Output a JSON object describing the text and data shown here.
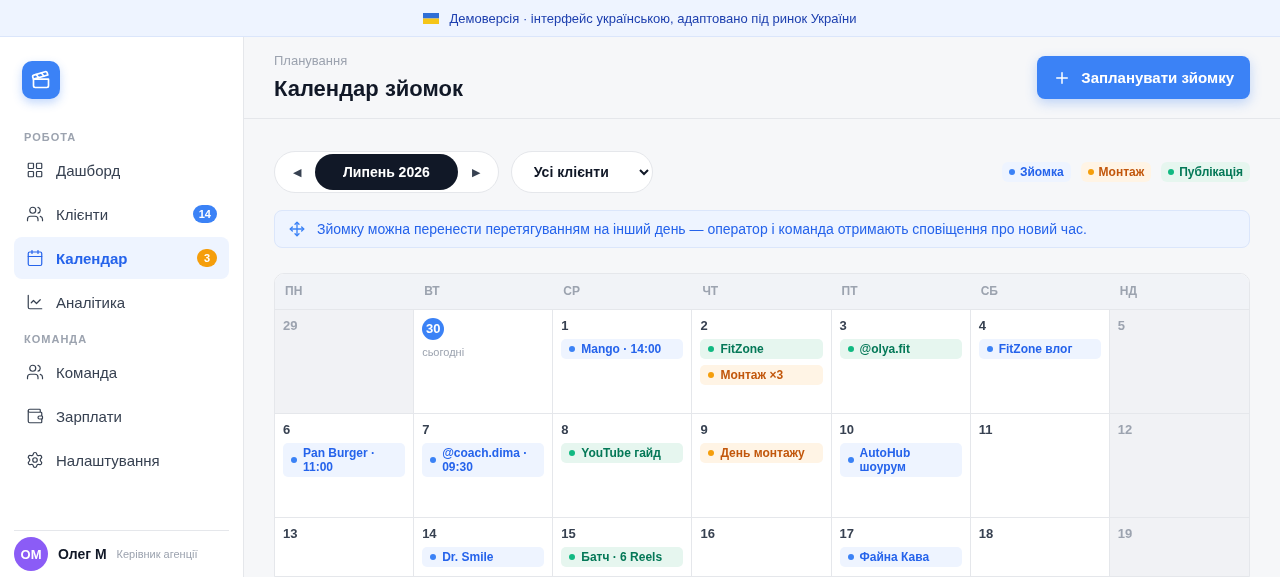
{
  "banner": {
    "text": "Демоверсія · інтерфейс українською, адаптовано під ринок України"
  },
  "sidebar": {
    "sections": [
      {
        "title": "РОБОТА",
        "items": [
          {
            "label": "Дашборд",
            "selected": false
          },
          {
            "label": "Клієнти",
            "selected": false,
            "badge": {
              "text": "14",
              "color": "#3b82f6"
            }
          },
          {
            "label": "Календар",
            "selected": true,
            "badge": {
              "text": "3",
              "color": "#f59e0b"
            }
          },
          {
            "label": "Аналітика",
            "selected": false
          }
        ]
      },
      {
        "title": "КОМАНДА",
        "items": [
          {
            "label": "Команда",
            "selected": false
          },
          {
            "label": "Зарплати",
            "selected": false
          },
          {
            "label": "Налаштування",
            "selected": false
          }
        ]
      }
    ],
    "user": {
      "initials": "ОМ",
      "name": "Олег М",
      "role": "Керівник агенції"
    }
  },
  "header": {
    "breadcrumb": "Планування",
    "title": "Календар зйомок",
    "action": "Запланувати зйомку"
  },
  "toolbar": {
    "prev": "◀",
    "month": "Липень 2026",
    "next": "▶",
    "client_filter": "Усі клієнти",
    "legend": [
      {
        "kind": "shoot",
        "label": "Зйомка"
      },
      {
        "kind": "edit",
        "label": "Монтаж"
      },
      {
        "kind": "publish",
        "label": "Публікація"
      }
    ]
  },
  "notice": "Зйомку можна перенести перетягуванням на інший день — оператор і команда отримають сповіщення про новий час.",
  "calendar": {
    "weekdays": [
      "ПН",
      "ВТ",
      "СР",
      "ЧТ",
      "ПТ",
      "СБ",
      "НД"
    ],
    "weeks": [
      [
        {
          "day": "29",
          "muted": true,
          "today": false
        },
        {
          "day": "30",
          "muted": false,
          "today": true,
          "today_label": "сьогодні"
        },
        {
          "day": "1",
          "muted": false,
          "today": false,
          "events": [
            {
              "kind": "shoot",
              "text": "Mango · 14:00"
            }
          ]
        },
        {
          "day": "2",
          "muted": false,
          "today": false,
          "events": [
            {
              "kind": "publish",
              "text": "FitZone"
            },
            {
              "kind": "edit",
              "text": "Монтаж ×3"
            }
          ]
        },
        {
          "day": "3",
          "muted": false,
          "today": false,
          "events": [
            {
              "kind": "publish",
              "text": "@olya.fit"
            }
          ]
        },
        {
          "day": "4",
          "muted": false,
          "today": false,
          "events": [
            {
              "kind": "shoot",
              "text": "FitZone влог"
            }
          ]
        },
        {
          "day": "5",
          "muted": true,
          "today": false
        }
      ],
      [
        {
          "day": "6",
          "muted": false,
          "today": false,
          "events": [
            {
              "kind": "shoot",
              "text": "Pan Burger · 11:00"
            }
          ]
        },
        {
          "day": "7",
          "muted": false,
          "today": false,
          "events": [
            {
              "kind": "shoot",
              "text": "@coach.dima · 09:30"
            }
          ]
        },
        {
          "day": "8",
          "muted": false,
          "today": false,
          "events": [
            {
              "kind": "publish",
              "text": "YouTube гайд"
            }
          ]
        },
        {
          "day": "9",
          "muted": false,
          "today": false,
          "events": [
            {
              "kind": "edit",
              "text": "День монтажу"
            }
          ]
        },
        {
          "day": "10",
          "muted": false,
          "today": false,
          "events": [
            {
              "kind": "shoot",
              "text": "AutoHub шоурум"
            }
          ]
        },
        {
          "day": "11",
          "muted": false,
          "today": false
        },
        {
          "day": "12",
          "muted": true,
          "today": false
        }
      ],
      [
        {
          "day": "13",
          "muted": false,
          "today": false
        },
        {
          "day": "14",
          "muted": false,
          "today": false,
          "events": [
            {
              "kind": "shoot",
              "text": "Dr. Smile"
            }
          ]
        },
        {
          "day": "15",
          "muted": false,
          "today": false,
          "events": [
            {
              "kind": "publish",
              "text": "Батч · 6 Reels"
            }
          ]
        },
        {
          "day": "16",
          "muted": false,
          "today": false
        },
        {
          "day": "17",
          "muted": false,
          "today": false,
          "events": [
            {
              "kind": "shoot",
              "text": "Файна Кава"
            }
          ]
        },
        {
          "day": "18",
          "muted": false,
          "today": false
        },
        {
          "day": "19",
          "muted": true,
          "today": false
        }
      ]
    ]
  }
}
